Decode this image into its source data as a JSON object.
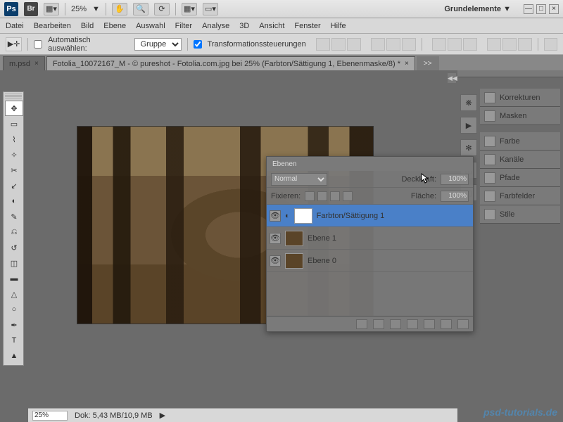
{
  "titlebar": {
    "zoom": "25%",
    "workspace": "Grundelemente"
  },
  "menu": {
    "datei": "Datei",
    "bearbeiten": "Bearbeiten",
    "bild": "Bild",
    "ebene": "Ebene",
    "auswahl": "Auswahl",
    "filter": "Filter",
    "analyse": "Analyse",
    "dreid": "3D",
    "ansicht": "Ansicht",
    "fenster": "Fenster",
    "hilfe": "Hilfe"
  },
  "options": {
    "auto_select_label": "Automatisch auswählen:",
    "auto_select_value": "Gruppe",
    "transform_label": "Transformationssteuerungen"
  },
  "tabs": {
    "t0": "m.psd",
    "t1": "Fotolia_10072167_M - © pureshot - Fotolia.com.jpg bei 25% (Farbton/Sättigung 1, Ebenenmaske/8) *",
    "more": ">>"
  },
  "status": {
    "zoom": "25%",
    "doc": "Dok: 5,43 MB/10,9 MB"
  },
  "rightdock": {
    "korrekturen": "Korrekturen",
    "masken": "Masken",
    "farbe": "Farbe",
    "kanaele": "Kanäle",
    "pfade": "Pfade",
    "farbfelder": "Farbfelder",
    "stile": "Stile"
  },
  "layers": {
    "title": "Ebenen",
    "blend": "Normal",
    "opacity_label": "Deckkraft:",
    "opacity_value": "100%",
    "lock_label": "Fixieren:",
    "fill_label": "Fläche:",
    "fill_value": "100%",
    "l0": "Farbton/Sättigung 1",
    "l1": "Ebene 1",
    "l2": "Ebene 0"
  },
  "watermark": "psd-tutorials.de"
}
